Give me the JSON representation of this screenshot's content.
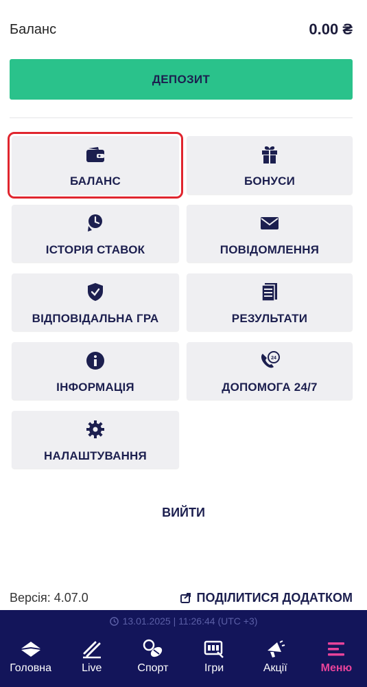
{
  "balance": {
    "label": "Баланс",
    "amount": "0.00 ₴"
  },
  "deposit": {
    "label": "ДЕПОЗИТ",
    "color": "#2ac28b"
  },
  "menu": {
    "balance": "БАЛАНС",
    "bonuses": "БОНУСИ",
    "bet_history": "ІСТОРІЯ СТАВОК",
    "messages": "ПОВІДОМЛЕННЯ",
    "responsible_gaming": "ВІДПОВІДАЛЬНА ГРА",
    "results": "РЕЗУЛЬТАТИ",
    "information": "ІНФОРМАЦІЯ",
    "support": "ДОПОМОГА 24/7",
    "settings": "НАЛАШТУВАННЯ"
  },
  "logout": "ВИЙТИ",
  "footer": {
    "version": "Версія: 4.07.0",
    "share": "ПОДІЛИТИСЯ ДОДАТКОМ"
  },
  "status": {
    "time": "13.01.2025 | 11:26:44 (UTC +3)"
  },
  "nav": {
    "home": "Головна",
    "live": "Live",
    "sport": "Спорт",
    "games": "Ігри",
    "promos": "Акції",
    "menu": "Меню"
  },
  "colors": {
    "navy": "#13155a",
    "accent_pink": "#e8439a",
    "highlight_red": "#e0252e"
  }
}
